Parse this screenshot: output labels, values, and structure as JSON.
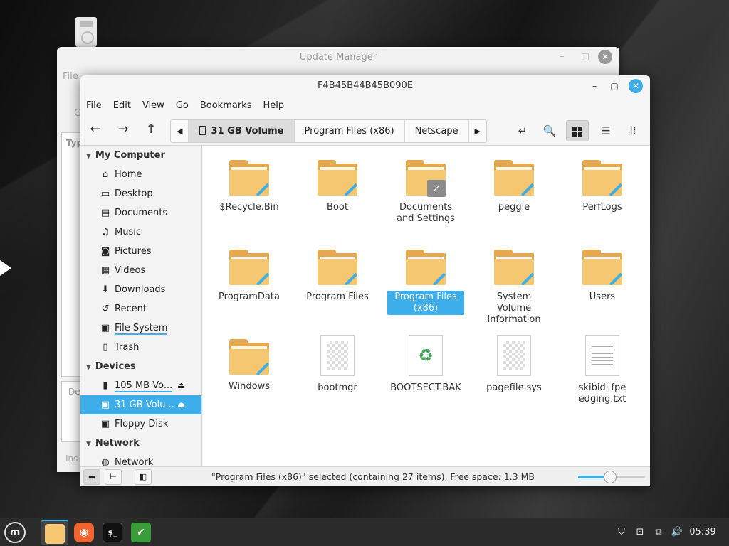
{
  "update_manager": {
    "title": "Update Manager",
    "menu_partial": "File",
    "label_c": "C",
    "col_partial": "Typ",
    "desc_partial": "De",
    "install_partial": "Ins",
    "min_glyph": "–",
    "max_glyph": "▢",
    "close_glyph": "✕"
  },
  "window": {
    "title": "F4B45B44B45B090E",
    "min_glyph": "–",
    "max_glyph": "▢",
    "close_glyph": "✕"
  },
  "menubar": [
    "File",
    "Edit",
    "View",
    "Go",
    "Bookmarks",
    "Help"
  ],
  "toolbar": {
    "back": "←",
    "forward": "→",
    "up": "↑",
    "crumb_prev": "◀",
    "crumb_next": "▶",
    "breadcrumbs": [
      "31 GB Volume",
      "Program Files (x86)",
      "Netscape"
    ],
    "open_terminal": "↵",
    "search": "🔍",
    "list_view": "☰",
    "compact_view": "⁞⁞"
  },
  "sidebar": {
    "sections": [
      {
        "title": "My Computer",
        "items": [
          {
            "label": "Home",
            "icon": "home-icon",
            "glyph": "⌂"
          },
          {
            "label": "Desktop",
            "icon": "desktop-icon",
            "glyph": "▭"
          },
          {
            "label": "Documents",
            "icon": "documents-icon",
            "glyph": "▤"
          },
          {
            "label": "Music",
            "icon": "music-icon",
            "glyph": "♫"
          },
          {
            "label": "Pictures",
            "icon": "camera-icon",
            "glyph": "◙"
          },
          {
            "label": "Videos",
            "icon": "film-icon",
            "glyph": "▦"
          },
          {
            "label": "Downloads",
            "icon": "download-icon",
            "glyph": "⬇"
          },
          {
            "label": "Recent",
            "icon": "history-icon",
            "glyph": "↺"
          },
          {
            "label": "File System",
            "icon": "drive-icon",
            "glyph": "▣"
          },
          {
            "label": "Trash",
            "icon": "trash-icon",
            "glyph": "▯"
          }
        ]
      },
      {
        "title": "Devices",
        "items": [
          {
            "label": "105 MB Vo...",
            "icon": "usb-icon",
            "glyph": "▮",
            "eject": "⏏"
          },
          {
            "label": "31 GB Volu...",
            "icon": "drive-icon",
            "glyph": "▣",
            "eject": "⏏"
          },
          {
            "label": "Floppy Disk",
            "icon": "floppy-icon",
            "glyph": "▣"
          }
        ]
      },
      {
        "title": "Network",
        "items": [
          {
            "label": "Network",
            "icon": "network-icon",
            "glyph": "◍"
          }
        ]
      }
    ]
  },
  "files": [
    {
      "name": "$Recycle.Bin",
      "type": "folder"
    },
    {
      "name": "Boot",
      "type": "folder"
    },
    {
      "name": "Documents and Settings",
      "type": "folder-link",
      "link_glyph": "↗"
    },
    {
      "name": "peggle",
      "type": "folder"
    },
    {
      "name": "PerfLogs",
      "type": "folder"
    },
    {
      "name": "ProgramData",
      "type": "folder"
    },
    {
      "name": "Program Files",
      "type": "folder"
    },
    {
      "name": "Program Files (x86)",
      "type": "folder",
      "selected": true
    },
    {
      "name": "System Volume Information",
      "type": "folder"
    },
    {
      "name": "Users",
      "type": "folder"
    },
    {
      "name": "Windows",
      "type": "folder"
    },
    {
      "name": "bootmgr",
      "type": "binary"
    },
    {
      "name": "BOOTSECT.BAK",
      "type": "backup",
      "glyph": "♻"
    },
    {
      "name": "pagefile.sys",
      "type": "binary"
    },
    {
      "name": "skibidi fpe edging.txt",
      "type": "text"
    }
  ],
  "statusbar": {
    "text": "\"Program Files (x86)\" selected (containing 27 items), Free space: 1.3 MB",
    "zoom_level": 0.48,
    "places_glyph": "▬",
    "tree_glyph": "⊢",
    "hide_glyph": "◧"
  },
  "taskbar": {
    "menu_glyph": "m",
    "terminal_glyph": "$_",
    "firefox_glyph": "◉",
    "shield_glyph": "✔",
    "clock": "05:39",
    "tray_glyphs": [
      "⛉",
      "⊡",
      "⧉",
      "🔊"
    ]
  },
  "colors": {
    "accent": "#3daee9",
    "folder": "#f5c770",
    "taskbar": "#2b2b2b"
  }
}
